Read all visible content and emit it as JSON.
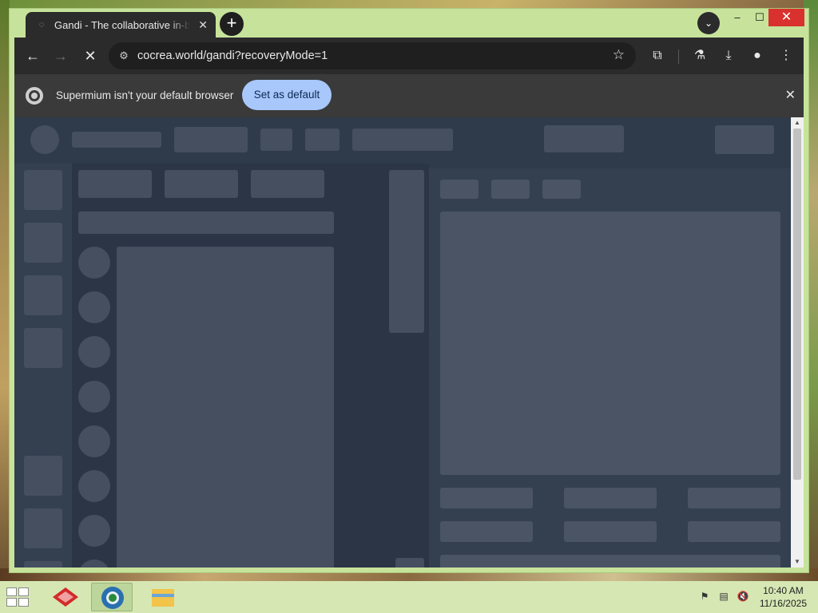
{
  "browser": {
    "tab_title": "Gandi - The collaborative in-browser",
    "tab_close": "✕",
    "new_tab": "+",
    "tab_search": "⌄",
    "window_controls": {
      "minimize": "–",
      "maximize": "☐",
      "close": "✕"
    },
    "nav": {
      "back": "←",
      "forward": "→",
      "stop": "✕"
    },
    "url": "cocrea.world/gandi?recoveryMode=1",
    "icons": [
      "site-info-icon",
      "bookmark-star-icon",
      "extensions-icon",
      "labs-icon",
      "download-icon",
      "profile-icon",
      "menu-icon"
    ]
  },
  "infobar": {
    "message": "Supermium isn't your default browser",
    "button": "Set as default",
    "dismiss": "✕"
  },
  "page": {
    "state": "loading-skeleton"
  },
  "taskbar": {
    "time": "10:40 AM",
    "date": "11/16/2025"
  },
  "colors": {
    "window_frame": "#c7e39b",
    "toolbar": "#2b2b2b",
    "infobar": "#3a3a3a",
    "accent_button": "#a8c7fa",
    "skeleton_bg": "#2f3a4a",
    "skeleton_block": "#454f60",
    "taskbar": "#d6e7b4"
  }
}
